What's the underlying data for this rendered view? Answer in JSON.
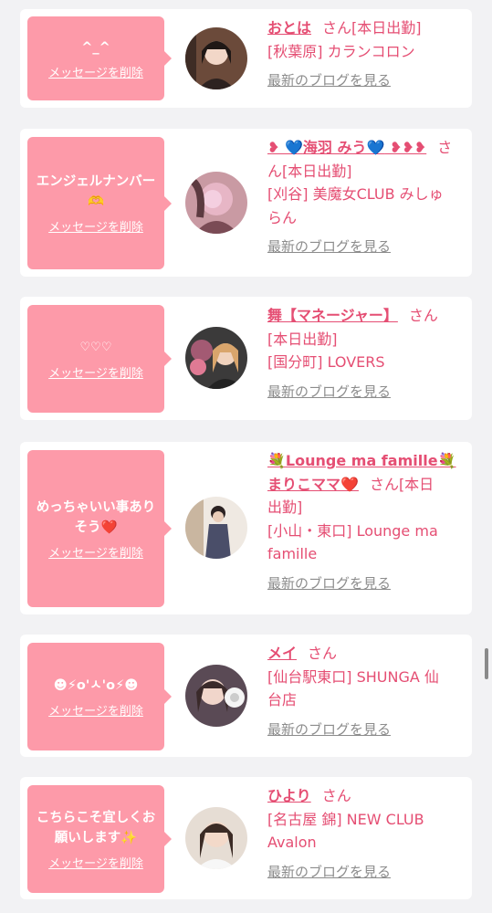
{
  "colors": {
    "background": "#f2f2f4",
    "card": "#ffffff",
    "bubble": "#fd9aa9",
    "accent": "#e54e73",
    "muted": "#8c8c8c"
  },
  "common": {
    "delete_label": "メッセージを削除",
    "blog_label": "最新のブログを見る",
    "honorific": "さん"
  },
  "cards": [
    {
      "message": "^_^",
      "name": "おとは",
      "detail_1": "[本日出勤]",
      "detail_2": "[秋葉原] カランコロン"
    },
    {
      "message": "エンジェルナンバー🫶",
      "name_prefix": "❥ ",
      "name_heart_1": "💙",
      "name": "海羽 みう",
      "name_heart_2": "💙",
      "name_suffix": " ❥❥❥",
      "honorific_split_1": "さ",
      "honorific_split_2": "ん",
      "detail_1": "[本日出勤]",
      "detail_2": "[刈谷] 美魔女CLUB みしゅ",
      "detail_3": "らん"
    },
    {
      "message": "♡♡♡",
      "name": "舞【マネージャー】",
      "detail_1": "[本日出勤]",
      "detail_2": "[国分町] LOVERS"
    },
    {
      "message": "めっちゃいい事ありそう❤️",
      "name_flower_1": "💐",
      "name_line_1": "Lounge ma famille",
      "name_flower_2": "💐",
      "name_line_2": "まりこママ",
      "name_heart": "❤️",
      "honorific_tail": "さん[本日",
      "detail_1": "出勤]",
      "detail_2": "[小山・東口] Lounge ma",
      "detail_3": "famille"
    },
    {
      "message": "☻⚡o'ㅅ'o⚡☻",
      "name": "メイ",
      "detail_1": "[仙台駅東口] SHUNGA 仙",
      "detail_2": "台店"
    },
    {
      "message": "こちらこそ宜しくお願いします✨",
      "name": "ひより",
      "detail_1": "[名古屋 錦] NEW CLUB",
      "detail_2": "Avalon"
    }
  ]
}
